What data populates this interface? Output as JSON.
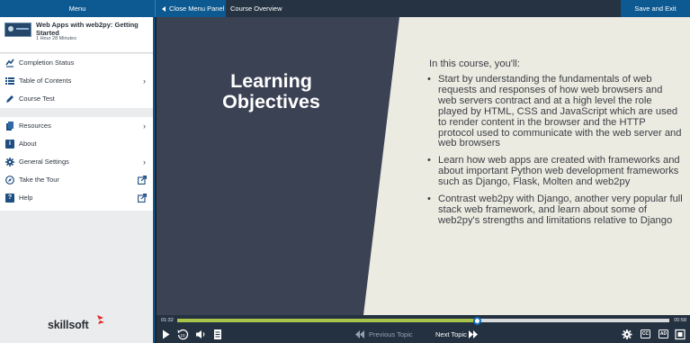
{
  "topbar": {
    "menu_label": "Menu",
    "close_panel_label": "Close Menu Panel",
    "course_overview_label": "Course Overview",
    "save_exit_label": "Save and Exit"
  },
  "course": {
    "title": "Web Apps with web2py: Getting Started",
    "duration": "1 Hour 28 Minutes"
  },
  "sidebar": {
    "group1": [
      {
        "label": "Completion Status",
        "icon": "completion-status-icon"
      },
      {
        "label": "Table of Contents",
        "icon": "list-icon",
        "chevron": true
      },
      {
        "label": "Course Test",
        "icon": "pencil-icon"
      }
    ],
    "group2": [
      {
        "label": "Resources",
        "icon": "resources-icon",
        "chevron": true
      },
      {
        "label": "About",
        "icon": "info-icon"
      },
      {
        "label": "General Settings",
        "icon": "gear-icon",
        "chevron": true
      },
      {
        "label": "Take the Tour",
        "icon": "compass-icon",
        "external": true
      },
      {
        "label": "Help",
        "icon": "help-icon",
        "external": true
      }
    ]
  },
  "brand": {
    "name": "skillsoft",
    "accent": "#e4262a"
  },
  "slide": {
    "heading_line1": "Learning",
    "heading_line2": "Objectives",
    "intro": "In this course, you'll:",
    "bullets": [
      "Start by understanding the fundamentals of web requests and responses of how web browsers and web servers contract and at a high level the role played by HTML, CSS and JavaScript which are used to render content in the browser and the HTTP protocol used to communicate with the web server and web browsers",
      "Learn how web apps are created with frameworks and about important Python web development frameworks such as Django, Flask, Molten and web2py",
      "Contrast web2py with Django, another very popular full stack web framework, and learn about some of web2py's strengths and limitations relative to Django"
    ],
    "dark_color": "#3b4254",
    "light_color": "#ecebe1"
  },
  "player": {
    "current_time": "01:32",
    "total_time": "00:58",
    "progress": 0.61,
    "prev_label": "Previous Topic",
    "next_label": "Next Topic",
    "cc_label": "CC",
    "ad_label": "AD",
    "accent": "#a8c34a"
  }
}
